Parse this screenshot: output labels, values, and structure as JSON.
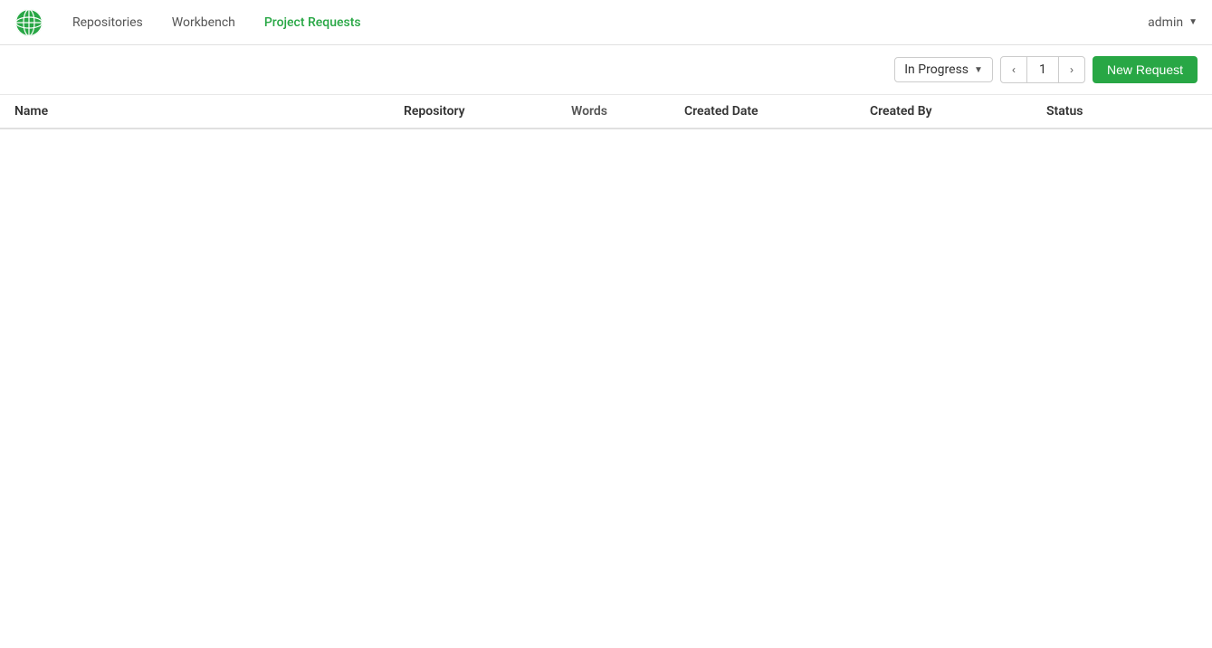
{
  "navbar": {
    "logo_alt": "globe-logo",
    "items": [
      {
        "label": "Repositories",
        "active": false
      },
      {
        "label": "Workbench",
        "active": false
      },
      {
        "label": "Project Requests",
        "active": true
      }
    ],
    "user": "admin",
    "dropdown_arrow": "▼"
  },
  "toolbar": {
    "filter": {
      "label": "In Progress",
      "caret": "▼"
    },
    "pagination": {
      "prev": "‹",
      "current": "1",
      "next": "›"
    },
    "new_request_label": "New Request"
  },
  "table": {
    "columns": [
      {
        "key": "name",
        "label": "Name"
      },
      {
        "key": "repository",
        "label": "Repository"
      },
      {
        "key": "words",
        "label": "Words"
      },
      {
        "key": "created_date",
        "label": "Created Date"
      },
      {
        "key": "created_by",
        "label": "Created By"
      },
      {
        "key": "status",
        "label": "Status"
      }
    ],
    "rows": []
  },
  "colors": {
    "active_nav": "#28a745",
    "new_request_bg": "#28a745",
    "globe_outer": "#2196c4",
    "globe_inner": "#ffffff"
  }
}
